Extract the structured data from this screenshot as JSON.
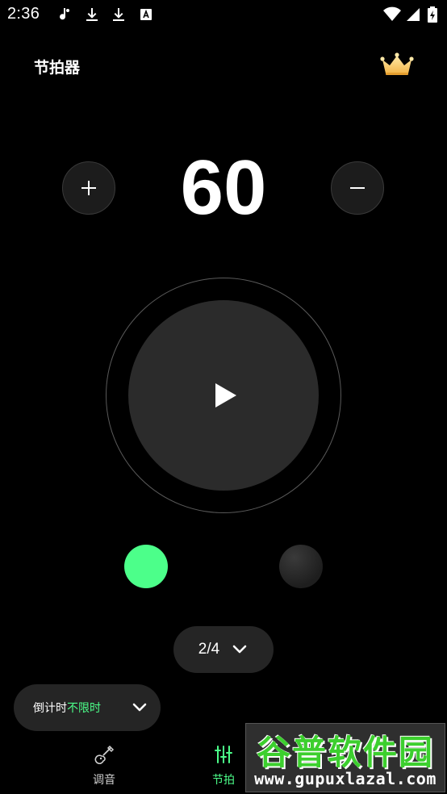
{
  "status_bar": {
    "time": "2:36",
    "icons": [
      "music-note-icon",
      "download-icon",
      "download-icon",
      "app-a-icon",
      "wifi-icon",
      "signal-icon",
      "battery-icon"
    ]
  },
  "header": {
    "title": "节拍器",
    "premium_icon": "crown-icon"
  },
  "tempo": {
    "value": "60",
    "increase_icon": "plus-icon",
    "decrease_icon": "minus-icon"
  },
  "player": {
    "state": "paused",
    "play_icon": "play-icon"
  },
  "beats": {
    "count": 2,
    "active_index": 0,
    "active_color": "#4cff8a",
    "inactive_color": "#2a2a2a"
  },
  "time_signature": {
    "value": "2/4"
  },
  "countdown": {
    "label": "倒计时",
    "value": "不限时"
  },
  "bottom_nav": {
    "items": [
      {
        "label": "调音",
        "icon": "guitar-icon",
        "active": false
      },
      {
        "label": "节拍",
        "icon": "sliders-icon",
        "active": true
      }
    ]
  },
  "watermark": {
    "title": "谷普软件园",
    "url": "www.gupuxlazal.com"
  },
  "colors": {
    "background": "#000000",
    "accent": "#4cff8a",
    "surface": "#252525"
  }
}
